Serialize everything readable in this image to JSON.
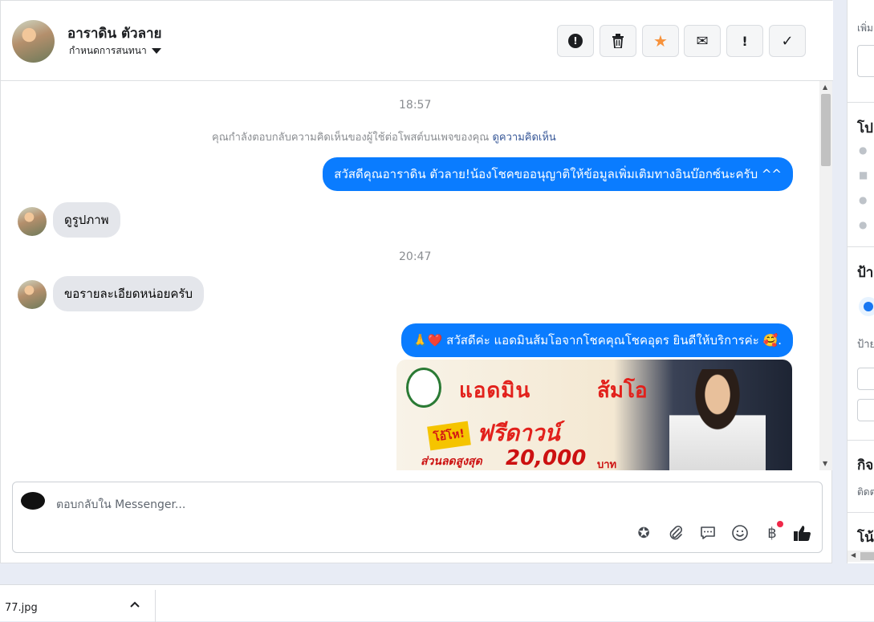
{
  "header": {
    "user_name": "อาราดิน ตัวลาย",
    "assign_label": "กำหนดการสนทนา",
    "actions": [
      {
        "name": "report-spam-button",
        "icon": "alert-circle-icon",
        "glyph": "❗"
      },
      {
        "name": "delete-button",
        "icon": "trash-icon",
        "glyph": "🗑"
      },
      {
        "name": "star-button",
        "icon": "star-icon",
        "glyph": "★"
      },
      {
        "name": "mark-unread-button",
        "icon": "envelope-icon",
        "glyph": "✉"
      },
      {
        "name": "follow-up-button",
        "icon": "exclamation-icon",
        "glyph": "!"
      },
      {
        "name": "mark-done-button",
        "icon": "check-icon",
        "glyph": "✓"
      }
    ]
  },
  "thread": {
    "timestamp_1": "18:57",
    "notice_text": "คุณกำลังตอบกลับความคิดเห็นของผู้ใช้ต่อโพสต์บนเพจของคุณ",
    "notice_link": "ดูความคิดเห็น",
    "msg_out_1": "สวัสดีคุณอาราดิน ตัวลาย!น้องโชคขออนุญาติให้ข้อมูลเพิ่มเติมทางอินบ๊อกซ์นะครับ ^^",
    "msg_in_1": "ดูรูปภาพ",
    "timestamp_2": "20:47",
    "msg_in_2": "ขอรายละเอียดหน่อยครับ",
    "msg_out_2": "🙏❤️ สวัสดีค่ะ แอดมินส้มโอจากโชคคุณโชคอุดร ยินดีให้บริการค่ะ 🥰.",
    "promo": {
      "title_left": "แอดมิน",
      "title_right": "ส้มโอ",
      "badge": "โอ้โห!",
      "free": "ฟรีดาวน์",
      "discount_label": "ส่วนลดสูงสุด",
      "amount": "20,000",
      "unit": "บาท"
    }
  },
  "composer": {
    "placeholder": "ตอบกลับใน Messenger...",
    "tools": [
      {
        "name": "saved-reply-icon",
        "glyph": "✪"
      },
      {
        "name": "attachment-icon",
        "glyph": "📎"
      },
      {
        "name": "chat-bubble-icon",
        "glyph": "💬"
      },
      {
        "name": "emoji-icon",
        "glyph": "☺"
      },
      {
        "name": "baht-icon",
        "glyph": "฿"
      },
      {
        "name": "thumbs-up-icon",
        "glyph": "👍"
      }
    ]
  },
  "right_panel": {
    "top_small": "เพิ่ม",
    "section_2": "โป",
    "section_3": "ป้า",
    "section_3_small": "ป้าย",
    "section_4": "กิจ",
    "section_4_small": "ติดต",
    "section_5": "โน้"
  },
  "download_bar": {
    "file_name": "77.jpg",
    "chevron": "^"
  },
  "colors": {
    "accent": "#0a7cff",
    "incoming_bubble": "#e4e6eb",
    "star": "#f7923b"
  }
}
